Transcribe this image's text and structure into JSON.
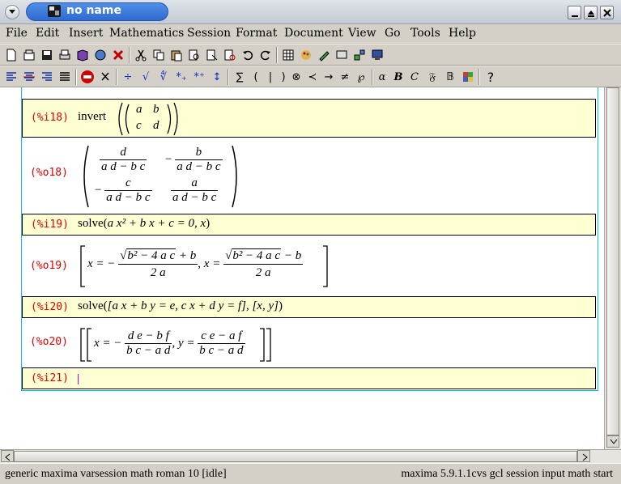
{
  "window": {
    "title": "no name"
  },
  "menu": [
    "File",
    "Edit",
    "Insert",
    "Mathematics",
    "Session",
    "Format",
    "Document",
    "View",
    "Go",
    "Tools",
    "Help"
  ],
  "cells": {
    "i18": {
      "label": "(%i18)",
      "fn": "invert",
      "matrix": [
        [
          "a",
          "b"
        ],
        [
          "c",
          "d"
        ]
      ]
    },
    "o18": {
      "label": "(%o18)",
      "matrix": [
        [
          {
            "sign": "",
            "num": "d",
            "den": "a d − b c"
          },
          {
            "sign": "−",
            "num": "b",
            "den": "a d − b c"
          }
        ],
        [
          {
            "sign": "−",
            "num": "c",
            "den": "a d − b c"
          },
          {
            "sign": "",
            "num": "a",
            "den": "a d − b c"
          }
        ]
      ]
    },
    "i19": {
      "label": "(%i19)",
      "fn": "solve",
      "args": "a x² + b x + c = 0, x"
    },
    "o19": {
      "label": "(%o19)",
      "lhs1": "x = −",
      "num1a": "b² − 4 a c",
      "num1b": " + b",
      "den1": "2 a",
      "lhs2": ", x =",
      "num2a": "b² − 4 a c",
      "num2b": " − b",
      "den2": "2 a"
    },
    "i20": {
      "label": "(%i20)",
      "fn": "solve",
      "args": "[a x + b y = e, c x + d y = f], [x, y]"
    },
    "o20": {
      "label": "(%o20)",
      "lhs1": "x = −",
      "num1": "d e − b f",
      "den1": "b c − a d",
      "lhs2": ", y =",
      "num2": "c e − a f",
      "den2": "b c − a d"
    },
    "i21": {
      "label": "(%i21)"
    }
  },
  "status": {
    "left": "generic maxima varsession math roman 10 [idle]",
    "right": "maxima 5.9.1.1cvs gcl session input math start"
  },
  "toolbar2_symbols": [
    "∑",
    "(",
    "|",
    ")",
    "⊗",
    "≺",
    "→",
    "≠",
    "℘",
    "α",
    "B",
    "C",
    "𝔉",
    "𝔹",
    "?"
  ]
}
